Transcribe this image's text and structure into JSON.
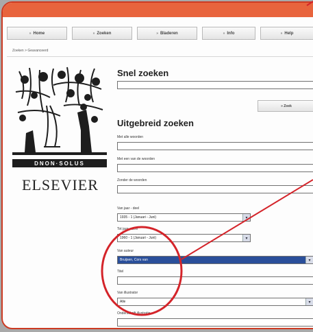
{
  "nav": [
    {
      "label": "Home",
      "arrow": "»"
    },
    {
      "label": "Zoeken",
      "arrow": "»"
    },
    {
      "label": "Bladeren",
      "arrow": "»"
    },
    {
      "label": "Info",
      "arrow": "»"
    },
    {
      "label": "Help",
      "arrow": "»"
    }
  ],
  "breadcrumb": "Zoeken > Geavanceerd",
  "logo": {
    "wordmark": "ELSEVIER",
    "band_text": "DNON·SOLUS"
  },
  "quick_search": {
    "title": "Snel zoeken",
    "value": "",
    "button_label": "» Zoek"
  },
  "advanced_search": {
    "title": "Uitgebreid zoeken",
    "all_words_label": "Met alle woorden",
    "any_word_label": "Met een van de woorden",
    "without_words_label": "Zonder de woorden",
    "year_from_label": "Van jaar - deel",
    "year_from_value": "1935 - 1 (Januari - Juni)",
    "year_to_label": "Tot jaar - deel",
    "year_to_value": "1960 - 1 (Januari - Juni)",
    "author_label": "Van auteur",
    "author_value": "Bruijsen, Cors van",
    "title_label": "Titel",
    "illustrator_label": "Van illustrator",
    "illustrator_value": "Alle",
    "caption_label": "Onderschrift illustratie"
  },
  "colors": {
    "accent": "#e8643d",
    "frame": "#cc3a22",
    "highlight": "#2a4f9a",
    "callout": "#d4242a"
  }
}
